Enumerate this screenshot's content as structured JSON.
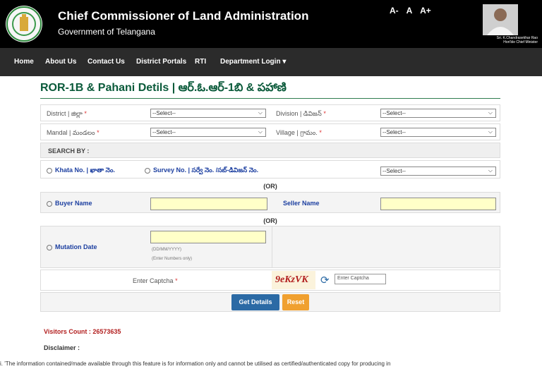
{
  "header": {
    "title": "Chief Commissioner of Land Administration",
    "subtitle": "Government of Telangana",
    "font_controls": [
      "A-",
      "A",
      "A+"
    ],
    "cm_name": "Sri. K.Chandrasekhar Rao",
    "cm_designation": "Hon'ble Chief Minister"
  },
  "nav": {
    "items": [
      "Home",
      "About Us",
      "Contact Us",
      "District Portals",
      "RTI",
      "Department Login ▾"
    ]
  },
  "page": {
    "title": "ROR-1B & Pahani Detils | ఆర్.ఓ.ఆర్-1బి & పహాణి"
  },
  "form": {
    "district_label": "District | జిల్లా",
    "division_label": "Division | డివిజన్",
    "mandal_label": "Mandal | మండలం",
    "village_label": "Village | గ్రామం.",
    "required_mark": "*",
    "select_placeholder": "--Select--",
    "search_by": "SEARCH BY :",
    "khata_label": "Khata No. | ఖాతా నెం.",
    "survey_label": "Survey No. | సర్వే నెం. /సబ్-డివిజన్ నెం.",
    "or_text": "(OR)",
    "buyer_label": "Buyer Name",
    "seller_label": "Seller Name",
    "mutation_label": "Mutation Date",
    "date_hint": "(DD/MM/YYYY)",
    "numbers_hint": "(Enter Numbers only)",
    "captcha_label": "Enter Captcha",
    "captcha_code": "9eKzVK",
    "captcha_placeholder": "Enter Captcha",
    "get_details": "Get Details",
    "reset": "Reset"
  },
  "footer": {
    "visitors": "Visitors Count : 26573635",
    "disclaimer_title": "Disclaimer :",
    "disclaimer_text": "i. 'The information contained/made available through this feature is for information only and cannot be utilised as certified/authenticated copy for producing in"
  },
  "colors": {
    "header_bg": "#000000",
    "nav_bg": "#2b2b2b",
    "title_green": "#0a5a3a",
    "link_blue": "#1c3fa0",
    "button_blue": "#2b6aa5",
    "button_orange": "#f0a030",
    "input_yellow": "#ffffc8",
    "visitors_red": "#b21e1e"
  }
}
